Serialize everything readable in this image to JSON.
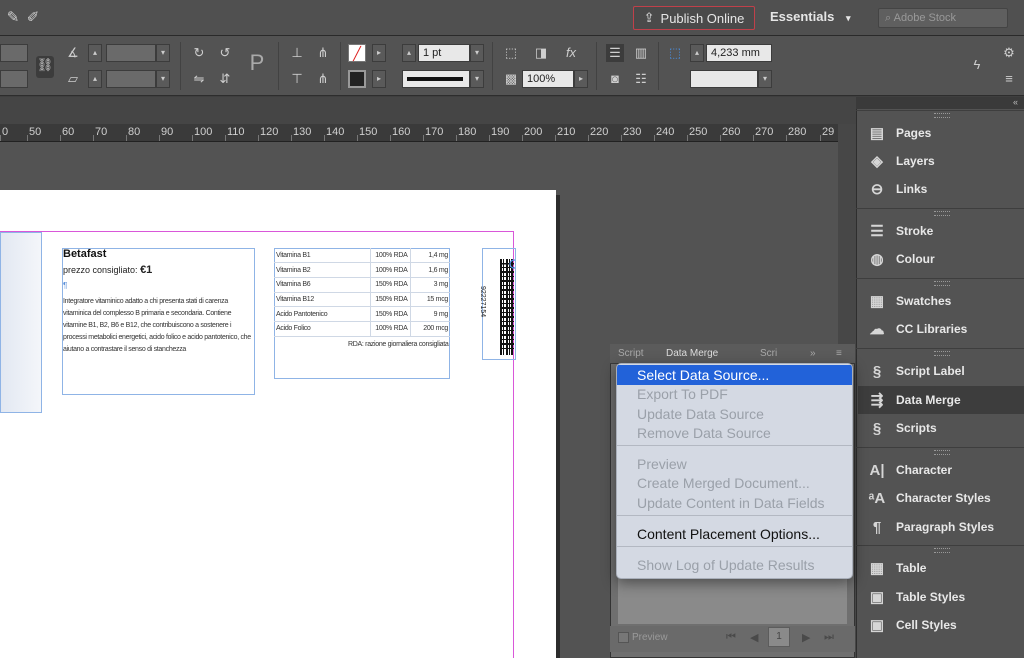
{
  "app_bar": {
    "publish_label": "Publish Online",
    "workspace_label": "Essentials",
    "workspace_caret": "▾",
    "search_placeholder": "Adobe Stock"
  },
  "control_panel": {
    "stroke_weight": "1 pt",
    "scale_value": "100%",
    "dimension_value": "4,233 mm"
  },
  "ruler": {
    "marks": [
      "0",
      "50",
      "60",
      "70",
      "80",
      "90",
      "100",
      "110",
      "120",
      "130",
      "140",
      "150",
      "160",
      "170",
      "180",
      "190",
      "200",
      "210",
      "220",
      "230",
      "240",
      "250",
      "260",
      "270",
      "280",
      "29"
    ]
  },
  "document": {
    "product_name": "Betafast",
    "price_label": "prezzo consigliato:",
    "price_value": "€1",
    "description": "Integratore vitaminico adatto a chi presenta stati di carenza vitaminica del complesso B primaria e secondaria. Contiene vitamine B1, B2, B6 e B12, che contribuiscono a sostenere i processi metabolici energetici, acido folico e acido pantotenico, che aiutano a contrastare il senso di stanchezza",
    "nutrition": [
      {
        "name": "Vitamina B1",
        "rda": "100% RDA",
        "amount": "1,4 mg"
      },
      {
        "name": "Vitamina B2",
        "rda": "100% RDA",
        "amount": "1,6 mg"
      },
      {
        "name": "Vitamina B6",
        "rda": "150% RDA",
        "amount": "3 mg"
      },
      {
        "name": "Vitamina B12",
        "rda": "150% RDA",
        "amount": "15 mcg"
      },
      {
        "name": "Acido Pantotenico",
        "rda": "150% RDA",
        "amount": "9 mg"
      },
      {
        "name": "Acido Folico",
        "rda": "100% RDA",
        "amount": "200 mcg"
      }
    ],
    "rda_note": "RDA: razione giornaliera consigliata",
    "barcode_number": "92227154"
  },
  "panels": [
    {
      "label": "Pages",
      "icon": "pages-icon",
      "glyph": "▤"
    },
    {
      "label": "Layers",
      "icon": "layers-icon",
      "glyph": "◈"
    },
    {
      "label": "Links",
      "icon": "links-icon",
      "glyph": "⊖"
    },
    {
      "label": "Stroke",
      "icon": "stroke-icon",
      "glyph": "☰"
    },
    {
      "label": "Colour",
      "icon": "colour-icon",
      "glyph": "◍"
    },
    {
      "label": "Swatches",
      "icon": "swatches-icon",
      "glyph": "▦"
    },
    {
      "label": "CC Libraries",
      "icon": "cc-libraries-icon",
      "glyph": "☁"
    },
    {
      "label": "Script Label",
      "icon": "script-label-icon",
      "glyph": "§"
    },
    {
      "label": "Data Merge",
      "icon": "data-merge-icon",
      "glyph": "⇶"
    },
    {
      "label": "Scripts",
      "icon": "scripts-icon",
      "glyph": "§"
    },
    {
      "label": "Character",
      "icon": "character-icon",
      "glyph": "A|"
    },
    {
      "label": "Character Styles",
      "icon": "character-styles-icon",
      "glyph": "ᵃA"
    },
    {
      "label": "Paragraph Styles",
      "icon": "paragraph-styles-icon",
      "glyph": "¶"
    },
    {
      "label": "Table",
      "icon": "table-icon",
      "glyph": "▦"
    },
    {
      "label": "Table Styles",
      "icon": "table-styles-icon",
      "glyph": "▣"
    },
    {
      "label": "Cell Styles",
      "icon": "cell-styles-icon",
      "glyph": "▣"
    }
  ],
  "data_merge_panel": {
    "tabs": [
      "Script",
      "Data Merge",
      "Scri"
    ],
    "preview_label": "Preview",
    "page_number": "1"
  },
  "menu": {
    "items": [
      {
        "label": "Select Data Source...",
        "enabled": true
      },
      {
        "label": "Export To PDF",
        "enabled": false
      },
      {
        "label": "Update Data Source",
        "enabled": false
      },
      {
        "label": "Remove Data Source",
        "enabled": false
      },
      {
        "label": "Preview",
        "enabled": false
      },
      {
        "label": "Create Merged Document...",
        "enabled": false
      },
      {
        "label": "Update Content in Data Fields",
        "enabled": false
      },
      {
        "label": "Content Placement Options...",
        "enabled": true
      },
      {
        "label": "Show Log of Update Results",
        "enabled": false
      }
    ]
  }
}
